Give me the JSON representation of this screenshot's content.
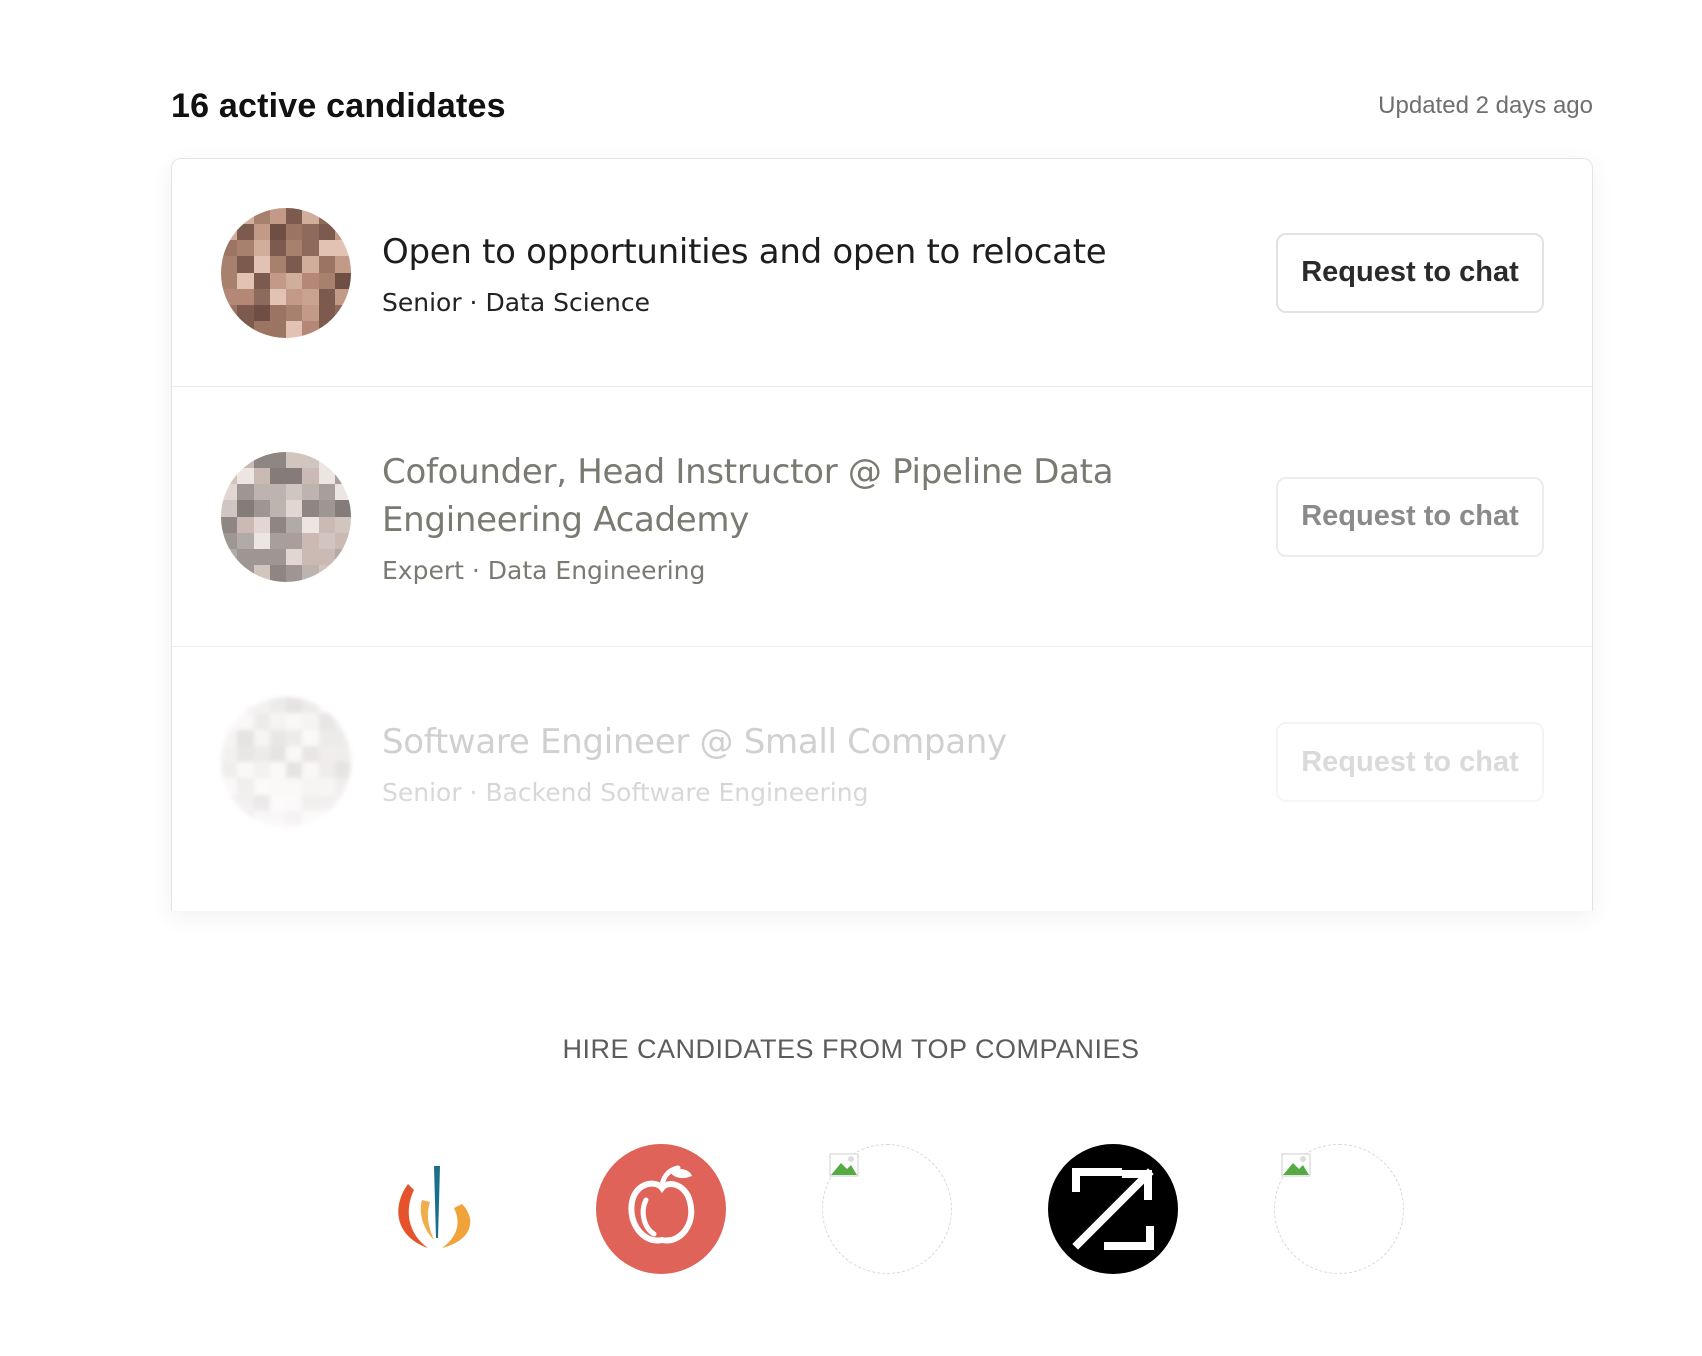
{
  "header": {
    "count_label": "16 active candidates",
    "updated_label": "Updated 2 days ago"
  },
  "candidates": [
    {
      "title": "Open to opportunities and open to relocate",
      "subtitle": "Senior · Data Science",
      "button_label": "Request to chat"
    },
    {
      "title": "Cofounder, Head Instructor @ Pipeline Data Engineering Academy",
      "subtitle": "Expert · Data Engineering",
      "button_label": "Request to chat"
    },
    {
      "title": "Software Engineer @ Small Company",
      "subtitle": "Senior · Backend Software Engineering",
      "button_label": "Request to chat"
    }
  ],
  "companies": {
    "heading": "HIRE CANDIDATES FROM TOP COMPANIES",
    "logos": [
      "novartis-logo",
      "apple-logo",
      "broken-image-logo",
      "ziprecruiter-logo",
      "broken-image-logo"
    ]
  },
  "colors": {
    "text_primary": "#1d1d1d",
    "text_muted": "#6f6f6f",
    "border": "#e4e4e4",
    "logo_red": "#e0635a",
    "logo_black": "#000000"
  }
}
